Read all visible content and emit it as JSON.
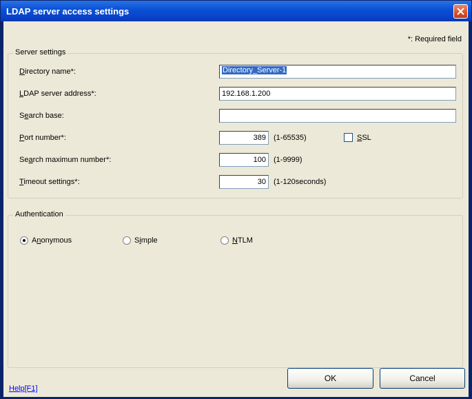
{
  "window": {
    "title": "LDAP server access settings"
  },
  "required_note": "*: Required field",
  "server_settings": {
    "legend": "Server settings",
    "directory_name": {
      "label_pre": "",
      "label_key": "D",
      "label_post": "irectory name*:",
      "value": "Directory_Server-1"
    },
    "ldap_address": {
      "label_pre": "",
      "label_key": "L",
      "label_post": "DAP server address*:",
      "value": "192.168.1.200"
    },
    "search_base": {
      "label_pre": "S",
      "label_key": "e",
      "label_post": "arch base:",
      "value": ""
    },
    "port_number": {
      "label_pre": "",
      "label_key": "P",
      "label_post": "ort number*:",
      "value": "389",
      "hint": "(1-65535)"
    },
    "ssl": {
      "label_key": "S",
      "label_post": "SL",
      "checked": false
    },
    "search_max": {
      "label_pre": "Se",
      "label_key": "a",
      "label_post": "rch maximum number*:",
      "value": "100",
      "hint": "(1-9999)"
    },
    "timeout": {
      "label_pre": "",
      "label_key": "T",
      "label_post": "imeout settings*:",
      "value": "30",
      "hint": "(1-120seconds)"
    }
  },
  "authentication": {
    "legend": "Authentication",
    "options": [
      {
        "pre": "A",
        "key": "n",
        "post": "onymous",
        "checked": true
      },
      {
        "pre": "S",
        "key": "i",
        "post": "mple",
        "checked": false
      },
      {
        "pre": "",
        "key": "N",
        "post": "TLM",
        "checked": false
      }
    ]
  },
  "footer": {
    "help_label": "Help[F1]",
    "ok_label": "OK",
    "cancel_label": "Cancel"
  }
}
